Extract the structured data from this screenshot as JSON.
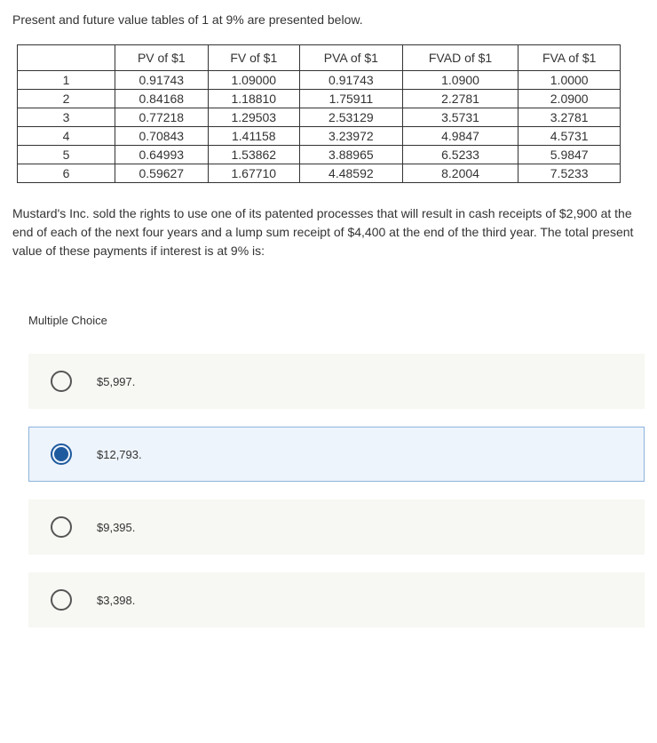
{
  "intro": "Present and future value tables of 1 at 9% are presented below.",
  "table": {
    "headers": [
      "",
      "PV of $1",
      "FV of $1",
      "PVA of $1",
      "FVAD of $1",
      "FVA of $1"
    ],
    "rows": [
      {
        "n": "1",
        "pv": "0.91743",
        "fv": "1.09000",
        "pva": "0.91743",
        "fvad": "1.0900",
        "fva": "1.0000"
      },
      {
        "n": "2",
        "pv": "0.84168",
        "fv": "1.18810",
        "pva": "1.75911",
        "fvad": "2.2781",
        "fva": "2.0900"
      },
      {
        "n": "3",
        "pv": "0.77218",
        "fv": "1.29503",
        "pva": "2.53129",
        "fvad": "3.5731",
        "fva": "3.2781"
      },
      {
        "n": "4",
        "pv": "0.70843",
        "fv": "1.41158",
        "pva": "3.23972",
        "fvad": "4.9847",
        "fva": "4.5731"
      },
      {
        "n": "5",
        "pv": "0.64993",
        "fv": "1.53862",
        "pva": "3.88965",
        "fvad": "6.5233",
        "fva": "5.9847"
      },
      {
        "n": "6",
        "pv": "0.59627",
        "fv": "1.67710",
        "pva": "4.48592",
        "fvad": "8.2004",
        "fva": "7.5233"
      }
    ]
  },
  "question": "Mustard's Inc. sold the rights to use one of its patented processes that will result in cash receipts of $2,900 at the end of each of the next four years and a lump sum receipt of $4,400 at the end of the third year. The total present value of these payments if interest is at 9% is:",
  "mcLabel": "Multiple Choice",
  "options": [
    {
      "label": "$5,997."
    },
    {
      "label": "$12,793."
    },
    {
      "label": "$9,395."
    },
    {
      "label": "$3,398."
    }
  ],
  "selectedIndex": 1
}
